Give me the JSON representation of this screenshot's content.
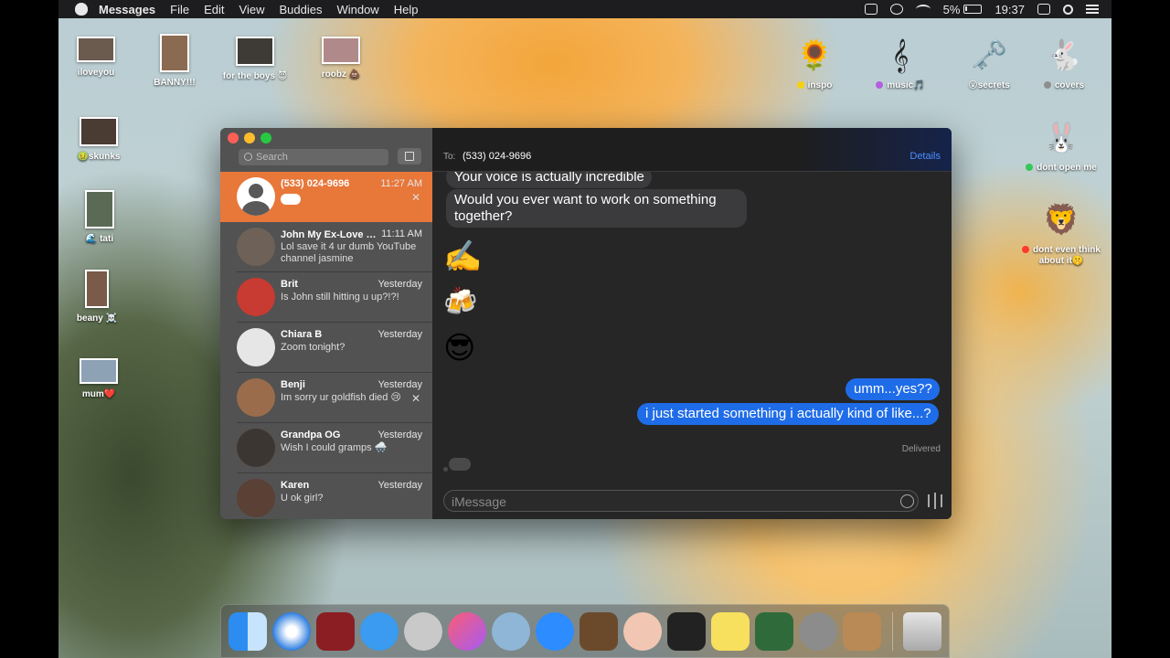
{
  "menubar": {
    "app_name": "Messages",
    "items": [
      "File",
      "Edit",
      "View",
      "Buddies",
      "Window",
      "Help"
    ],
    "battery": "5%",
    "clock": "19:37"
  },
  "desktop_icons": [
    {
      "label": "iloveyou"
    },
    {
      "label": "BANNY!!!"
    },
    {
      "label": "for the boys 😈"
    },
    {
      "label": "roobz 💩"
    },
    {
      "label": "inspo"
    },
    {
      "label": "music🎵"
    },
    {
      "label": "😮secrets"
    },
    {
      "label": "covers"
    },
    {
      "label": "🤢skunks"
    },
    {
      "label": "🌊 tati"
    },
    {
      "label": "beany ☠️"
    },
    {
      "label": "mum❤️"
    },
    {
      "label": "dont open me"
    },
    {
      "label": "dont even think about it🤫"
    }
  ],
  "colors": {
    "active_conversation": "#e8773a",
    "outgoing_bubble": "#1f6ce8",
    "incoming_bubble": "#3b3b3d",
    "details_link": "#4a90ff"
  },
  "sidebar": {
    "search_placeholder": "Search",
    "conversations": [
      {
        "name": "(533) 024-9696",
        "time": "11:27 AM",
        "preview": ""
      },
      {
        "name": "John My Ex-Love 🤢...",
        "time": "11:11 AM",
        "preview": "Lol save it 4 ur dumb YouTube channel jasmine"
      },
      {
        "name": "Brit",
        "time": "Yesterday",
        "preview": "Is John still hitting u up?!?!"
      },
      {
        "name": "Chiara B",
        "time": "Yesterday",
        "preview": "Zoom tonight?"
      },
      {
        "name": "Benji",
        "time": "Yesterday",
        "preview": "Im sorry ur goldfish died 😢"
      },
      {
        "name": "Grandpa OG",
        "time": "Yesterday",
        "preview": "Wish I could gramps 🌨️"
      },
      {
        "name": "Karen",
        "time": "Yesterday",
        "preview": "U ok girl?"
      }
    ]
  },
  "chat": {
    "to_label": "To:",
    "recipient": "(533) 024-9696",
    "details_label": "Details",
    "messages": [
      {
        "dir": "in",
        "text": "Your voice is actually incredible"
      },
      {
        "dir": "in",
        "text": "Would you ever want to work on something together?"
      },
      {
        "dir": "in",
        "text": "✍️"
      },
      {
        "dir": "in",
        "text": "🍻"
      },
      {
        "dir": "in",
        "text": "😎"
      },
      {
        "dir": "out",
        "text": "umm...yes??"
      },
      {
        "dir": "out",
        "text": "i just started something i actually kind of like...?"
      }
    ],
    "status": "Delivered",
    "composer_placeholder": "iMessage"
  }
}
